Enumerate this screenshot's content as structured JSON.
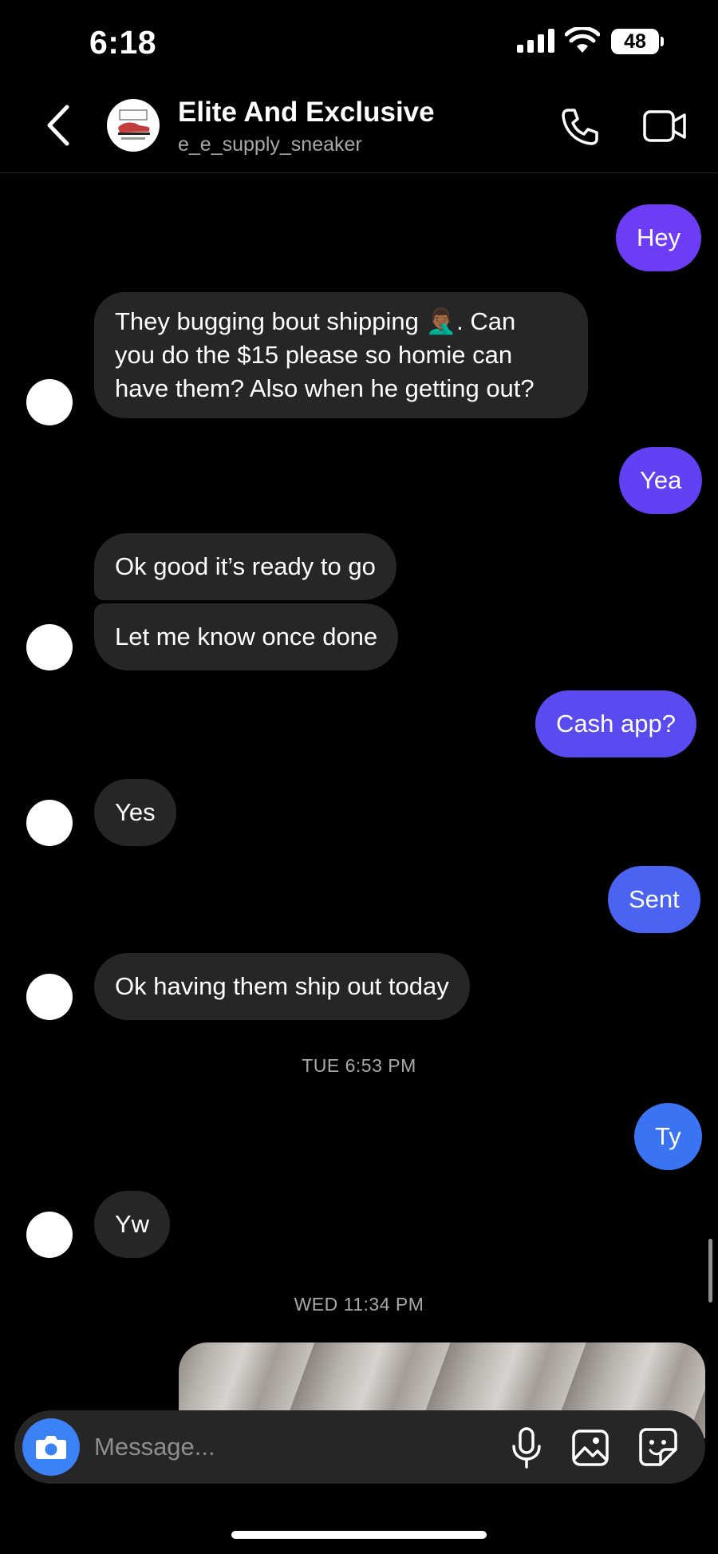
{
  "status": {
    "time": "6:18",
    "battery": "48"
  },
  "header": {
    "name": "Elite And Exclusive",
    "username": "e_e_supply_sneaker"
  },
  "messages": {
    "m1": "Hey",
    "m2_l1": "They bugging bout shipping 🤦🏾‍♂️. Can",
    "m2_l2": "you do the $15 please so homie can",
    "m2_l3": "have them? Also when he getting out?",
    "m3": "Yea",
    "m4": "Ok good it’s ready to go",
    "m5": "Let me know once done",
    "m6": "Cash app?",
    "m7": "Yes",
    "m8": "Sent",
    "m9": "Ok having them ship out today",
    "m10": "Ty",
    "m11": "Yw"
  },
  "timestamps": {
    "t1": "TUE 6:53 PM",
    "t2": "WED 11:34 PM"
  },
  "composer": {
    "placeholder": "Message..."
  },
  "colors": {
    "outgoing_purple": "#6d3cf5",
    "outgoing_blue": "#4a63f0",
    "incoming": "#262626",
    "accent_blue": "#3b82f6"
  }
}
